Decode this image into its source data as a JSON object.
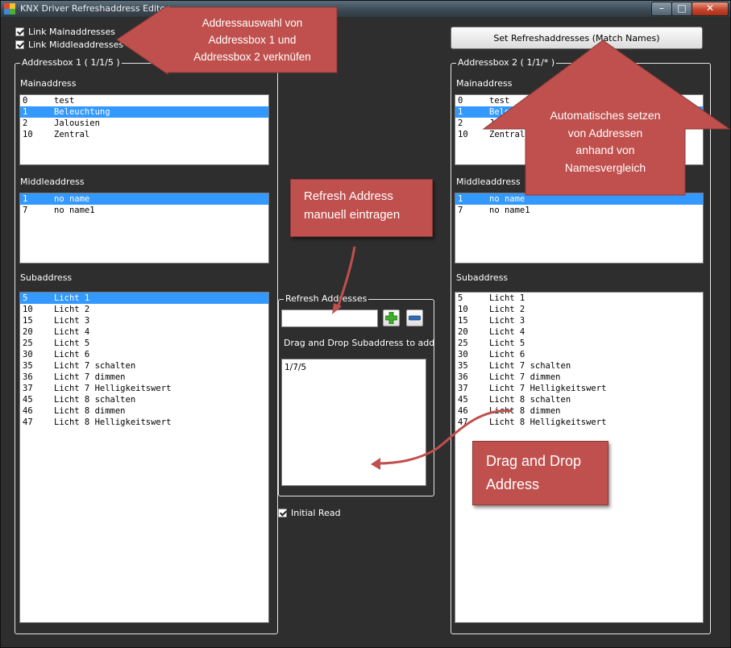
{
  "window": {
    "title": "KNX Driver Refreshaddress Editor",
    "controls": {
      "minimize": "–",
      "maximize": "□",
      "close": "✕"
    }
  },
  "options": {
    "link_mainaddresses": "Link Mainaddresses",
    "link_middleaddresses": "Link Middleaddresses",
    "initial_read": "Initial Read"
  },
  "set_button": "Set Refreshaddresses (Match Names)",
  "box1": {
    "title": "Addressbox 1 ( 1/1/5 )",
    "main_label": "Mainaddress",
    "middle_label": "Middleaddress",
    "sub_label": "Subaddress",
    "main": [
      {
        "n": "0",
        "t": "test",
        "sel": false
      },
      {
        "n": "1",
        "t": "Beleuchtung",
        "sel": true
      },
      {
        "n": "2",
        "t": "Jalousien",
        "sel": false
      },
      {
        "n": "10",
        "t": "Zentral",
        "sel": false
      }
    ],
    "middle": [
      {
        "n": "1",
        "t": "no name",
        "sel": true
      },
      {
        "n": "7",
        "t": "no name1",
        "sel": false
      }
    ],
    "sub": [
      {
        "n": "5",
        "t": "Licht 1",
        "sel": true
      },
      {
        "n": "10",
        "t": "Licht 2",
        "sel": false
      },
      {
        "n": "15",
        "t": "Licht 3",
        "sel": false
      },
      {
        "n": "20",
        "t": "Licht 4",
        "sel": false
      },
      {
        "n": "25",
        "t": "Licht 5",
        "sel": false
      },
      {
        "n": "30",
        "t": "Licht 6",
        "sel": false
      },
      {
        "n": "35",
        "t": "Licht 7 schalten",
        "sel": false
      },
      {
        "n": "36",
        "t": "Licht 7 dimmen",
        "sel": false
      },
      {
        "n": "37",
        "t": "Licht 7 Helligkeitswert",
        "sel": false
      },
      {
        "n": "45",
        "t": "Licht 8 schalten",
        "sel": false
      },
      {
        "n": "46",
        "t": "Licht 8 dimmen",
        "sel": false
      },
      {
        "n": "47",
        "t": "Licht 8 Helligkeitswert",
        "sel": false
      }
    ]
  },
  "box2": {
    "title": "Addressbox 2 ( 1/1/* )",
    "main_label": "Mainaddress",
    "middle_label": "Middleaddress",
    "sub_label": "Subaddress",
    "main": [
      {
        "n": "0",
        "t": "test",
        "sel": false
      },
      {
        "n": "1",
        "t": "Beleuchtung",
        "sel": true
      },
      {
        "n": "2",
        "t": "Jalousien",
        "sel": false
      },
      {
        "n": "10",
        "t": "Zentral",
        "sel": false
      }
    ],
    "middle": [
      {
        "n": "1",
        "t": "no name",
        "sel": true
      },
      {
        "n": "7",
        "t": "no name1",
        "sel": false
      }
    ],
    "sub": [
      {
        "n": "5",
        "t": "Licht 1",
        "sel": false
      },
      {
        "n": "10",
        "t": "Licht 2",
        "sel": false
      },
      {
        "n": "15",
        "t": "Licht 3",
        "sel": false
      },
      {
        "n": "20",
        "t": "Licht 4",
        "sel": false
      },
      {
        "n": "25",
        "t": "Licht 5",
        "sel": false
      },
      {
        "n": "30",
        "t": "Licht 6",
        "sel": false
      },
      {
        "n": "35",
        "t": "Licht 7 schalten",
        "sel": false
      },
      {
        "n": "36",
        "t": "Licht 7 dimmen",
        "sel": false
      },
      {
        "n": "37",
        "t": "Licht 7 Helligkeitswert",
        "sel": false
      },
      {
        "n": "45",
        "t": "Licht 8 schalten",
        "sel": false
      },
      {
        "n": "46",
        "t": "Licht 8 dimmen",
        "sel": false
      },
      {
        "n": "47",
        "t": "Licht 8 Helligkeitswert",
        "sel": false
      }
    ]
  },
  "refresh": {
    "title": "Refresh Addresses",
    "input_value": "",
    "hint": "Drag and Drop Subaddress to add",
    "items": [
      "1/7/5"
    ]
  },
  "annotations": {
    "link": [
      "Addressauswahl von",
      "Addressbox 1 und",
      "Addressbox 2 verknüfen"
    ],
    "manual": [
      "Refresh Address",
      "manuell eintragen"
    ],
    "auto": [
      "Automatisches setzen",
      "von Addressen",
      "anhand von",
      "Namesvergleich"
    ],
    "drag": [
      "Drag and Drop",
      "Address"
    ]
  },
  "colors": {
    "background": "#2e2e2e",
    "selection": "#3399ff",
    "annotation": "#c0504d",
    "add": "#3fae2a",
    "remove": "#2f6db5"
  },
  "icons": {
    "app": "app-icon",
    "add": "plus-icon",
    "remove": "minus-icon"
  }
}
